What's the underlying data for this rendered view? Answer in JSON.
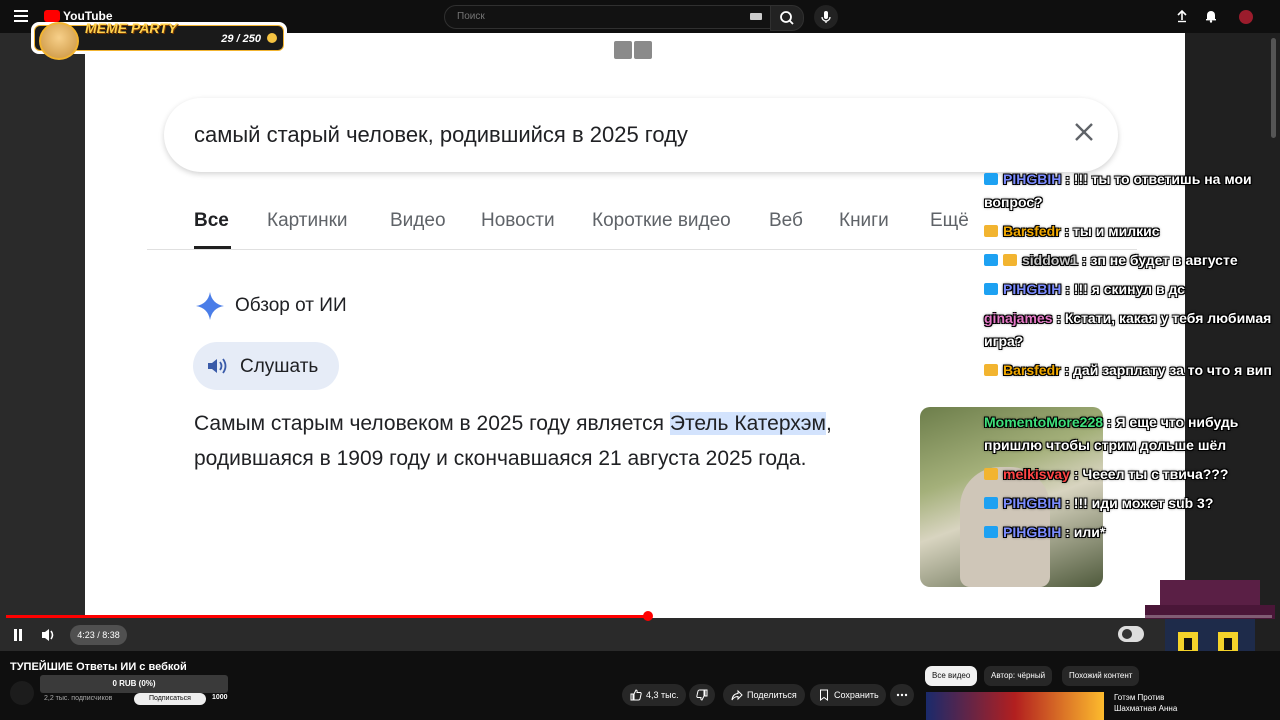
{
  "topbar": {
    "logo_text": "YouTube",
    "search_placeholder": "Поиск"
  },
  "overlay": {
    "brand": "MEME PARTY",
    "counter": "29 / 250"
  },
  "video_content": {
    "search_query": "самый старый человек, родившийся в 2025 году",
    "tabs": [
      "Все",
      "Картинки",
      "Видео",
      "Новости",
      "Короткие видео",
      "Веб",
      "Книги",
      "Ещё"
    ],
    "active_tab": "Все",
    "ai_overview_title": "Обзор от ИИ",
    "listen_label": "Слушать",
    "answer_before": "Самым старым человеком в 2025 году является ",
    "answer_highlight": "Этель Катерхэм",
    "answer_after": ", родившаяся в 1909 году и скончавшаяся 21 августа 2025 года."
  },
  "chat": [
    {
      "user": "PIHGBIH",
      "user_color": "#7b8cff",
      "badges": [
        "blue"
      ],
      "text": ": !!! ты то ответишь на мои вопрос?"
    },
    {
      "user": "Barsfedr",
      "user_color": "#f2a900",
      "badges": [
        "gold"
      ],
      "text": ": ты и милкис"
    },
    {
      "user": "siddow1",
      "user_color": "#c8c8c8",
      "badges": [
        "blue",
        "gold"
      ],
      "text": ": зп не будет в августе"
    },
    {
      "user": "PIHGBIH",
      "user_color": "#7b8cff",
      "badges": [
        "blue"
      ],
      "text": ": !!! я скинул в дс"
    },
    {
      "user": "ginajames",
      "user_color": "#e67ac8",
      "badges": [],
      "text": ": Кстати, какая у тебя любимая игра?"
    },
    {
      "user": "Barsfedr",
      "user_color": "#f2a900",
      "badges": [
        "gold"
      ],
      "text": ": дай зарплату за то что я вип"
    },
    {
      "user": "MomentoMore228",
      "user_color": "#3ee07a",
      "badges": [],
      "text": ": Я еще что нибудь пришлю чтобы стрим дольше шёл"
    },
    {
      "user": "melkisvay",
      "user_color": "#ff4545",
      "badges": [
        "gold"
      ],
      "text": ": Чееел ты с твича???"
    },
    {
      "user": "PIHGBIH",
      "user_color": "#7b8cff",
      "badges": [
        "blue"
      ],
      "text": ": !!! иди может sub 3?"
    },
    {
      "user": "PIHGBIH",
      "user_color": "#7b8cff",
      "badges": [
        "blue"
      ],
      "text": ": или*"
    }
  ],
  "player": {
    "time": "4:23 / 8:38",
    "progress": 0.507
  },
  "below": {
    "video_title": "ТУПЕЙШИЕ Ответы ИИ с вебкой",
    "donation": "0 RUB (0%)",
    "subscribers": "2,2 тыс. подписчиков",
    "subscribe_label": "Подписаться",
    "sub_goal": "1000",
    "likes": "4,3 тыс.",
    "share": "Поделиться",
    "save": "Сохранить",
    "chips": [
      "Все видео",
      "Автор: чёрный",
      "Похожий контент"
    ],
    "rec_title": "Готэм Против Шахматная Анна"
  },
  "colors": {
    "accent_red": "#ff0000",
    "highlight": "#d3e3fd",
    "overlay_gold": "#ffd24d"
  }
}
